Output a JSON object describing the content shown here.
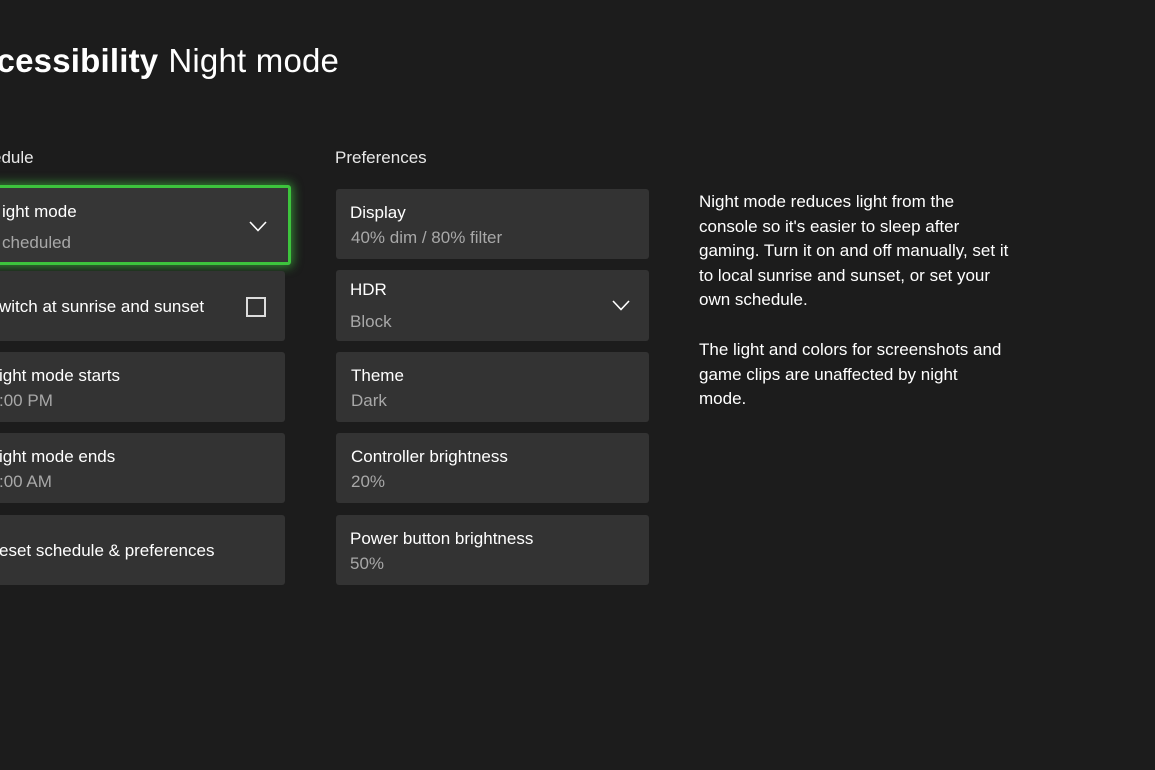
{
  "header": {
    "title_bold": "ccessibility",
    "title_rest": "Night mode"
  },
  "schedule": {
    "label": "edule",
    "items": [
      {
        "label": "ight mode",
        "value": "cheduled"
      },
      {
        "label": "witch at sunrise and sunset",
        "checked": false
      },
      {
        "label": "ight mode starts",
        "value": ":00 PM"
      },
      {
        "label": "ight mode ends",
        "value": ":00 AM"
      },
      {
        "label": "eset schedule & preferences"
      }
    ]
  },
  "preferences": {
    "label": "Preferences",
    "items": [
      {
        "label": "Display",
        "value": "40% dim / 80% filter"
      },
      {
        "label": "HDR",
        "value": "Block"
      },
      {
        "label": "Theme",
        "value": "Dark"
      },
      {
        "label": "Controller brightness",
        "value": "20%"
      },
      {
        "label": "Power button brightness",
        "value": "50%"
      }
    ]
  },
  "description": {
    "paragraph1": "Night mode reduces light from the console so it's easier to sleep after gaming. Turn it on and off manually, set it to local sunrise and sunset, or set your own schedule.",
    "paragraph2": "The light and colors for screenshots and game clips are unaffected by night mode."
  },
  "colors": {
    "background": "#1c1c1c",
    "tile": "#333333",
    "focus": "#3dc43d",
    "secondary_text": "#a8a8a8"
  }
}
